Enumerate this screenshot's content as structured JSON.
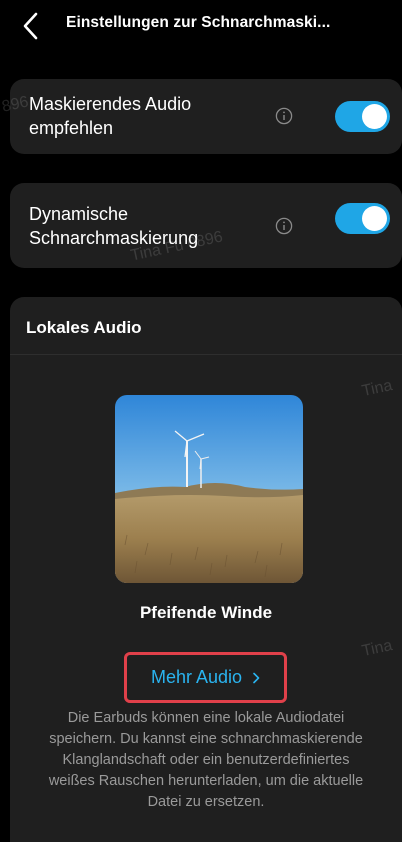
{
  "header": {
    "title": "Einstellungen zur Schnarchmaski..."
  },
  "settings": [
    {
      "label_line1": "Maskierendes Audio",
      "label_line2": "empfehlen",
      "enabled": true
    },
    {
      "label_line1": "Dynamische",
      "label_line2": "Schnarchmaskierung",
      "enabled": true
    }
  ],
  "local_audio": {
    "section_title": "Lokales Audio",
    "sound_name": "Pfeifende Winde",
    "more_audio_label": "Mehr Audio",
    "description": "Die Earbuds können eine lokale Audiodatei speichern. Du kannst eine schnarchmaskierende Klanglandschaft oder ein benutzerdefiniertes weißes Rauschen herunterladen, um die aktuelle Datei zu ersetzen."
  },
  "watermark": {
    "text_1": "Tina Fu 0896",
    "text_2": "896",
    "text_3": "Tina",
    "text_4": "Tina"
  },
  "icons": {
    "back": "chevron-left-icon",
    "info": "info-icon",
    "more": "chevron-right-icon"
  },
  "colors": {
    "toggle_on": "#1fa6e6",
    "link": "#2ab4f0",
    "highlight_border": "#e0404a",
    "card_bg": "#1f1f1f"
  }
}
